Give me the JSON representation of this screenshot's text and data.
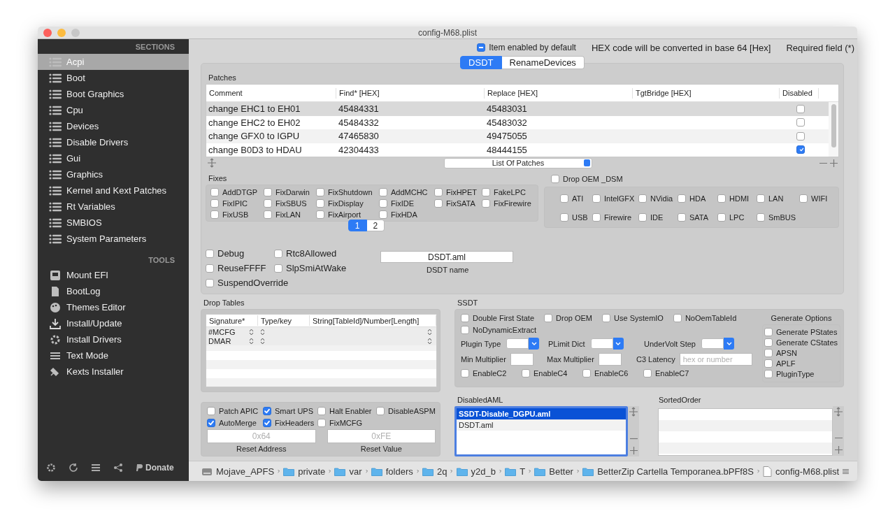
{
  "window": {
    "title": "config-M68.plist"
  },
  "sidebar": {
    "header": "SECTIONS",
    "items": [
      {
        "label": "Acpi",
        "selected": true
      },
      {
        "label": "Boot",
        "selected": false
      },
      {
        "label": "Boot Graphics",
        "selected": false
      },
      {
        "label": "Cpu",
        "selected": false
      },
      {
        "label": "Devices",
        "selected": false
      },
      {
        "label": "Disable Drivers",
        "selected": false
      },
      {
        "label": "Gui",
        "selected": false
      },
      {
        "label": "Graphics",
        "selected": false
      },
      {
        "label": "Kernel and Kext Patches",
        "selected": false
      },
      {
        "label": "Rt Variables",
        "selected": false
      },
      {
        "label": "SMBIOS",
        "selected": false
      },
      {
        "label": "System Parameters",
        "selected": false
      }
    ],
    "tools_header": "TOOLS",
    "tools": [
      {
        "label": "Mount EFI",
        "selected": false
      },
      {
        "label": "BootLog",
        "selected": false
      },
      {
        "label": "Themes Editor",
        "selected": false
      },
      {
        "label": "Install/Update",
        "selected": false
      },
      {
        "label": "Install Drivers",
        "selected": false
      },
      {
        "label": "Text Mode",
        "selected": false
      },
      {
        "label": "Kexts Installer",
        "selected": false
      }
    ],
    "donate": "Donate"
  },
  "header": {
    "item_enabled": {
      "label": "Item enabled by default",
      "mixed": true
    },
    "hex_note": "HEX code will be converted in base 64 [Hex]",
    "required_note": "Required field (*)"
  },
  "tabs": [
    {
      "label": "DSDT",
      "selected": true
    },
    {
      "label": "RenameDevices",
      "selected": false
    }
  ],
  "patches": {
    "title": "Patches",
    "columns": [
      "Comment",
      "Find* [HEX]",
      "Replace [HEX]",
      "TgtBridge [HEX]",
      "Disabled"
    ],
    "rows": [
      {
        "comment": "change EHC1 to EH01",
        "find": "45484331",
        "replace": "45483031",
        "disabled": false
      },
      {
        "comment": "change EHC2 to EH02",
        "find": "45484332",
        "replace": "45483032",
        "disabled": false
      },
      {
        "comment": "change GFX0 to IGPU",
        "find": "47465830",
        "replace": "49475055",
        "disabled": false
      },
      {
        "comment": "change B0D3 to HDAU",
        "find": "42304433",
        "replace": "48444155",
        "disabled": true
      }
    ],
    "list_popup": "List Of Patches"
  },
  "fixes": {
    "title": "Fixes",
    "items": [
      {
        "label": "AddDTGP",
        "checked": false
      },
      {
        "label": "FixDarwin",
        "checked": false
      },
      {
        "label": "FixShutdown",
        "checked": false
      },
      {
        "label": "AddMCHC",
        "checked": false
      },
      {
        "label": "FixHPET",
        "checked": false
      },
      {
        "label": "FakeLPC",
        "checked": false
      },
      {
        "label": "FixIPIC",
        "checked": false
      },
      {
        "label": "FixSBUS",
        "checked": false
      },
      {
        "label": "FixDisplay",
        "checked": false
      },
      {
        "label": "FixIDE",
        "checked": false
      },
      {
        "label": "FixSATA",
        "checked": false
      },
      {
        "label": "FixFirewire",
        "checked": false
      },
      {
        "label": "FixUSB",
        "checked": false
      },
      {
        "label": "FixLAN",
        "checked": false
      },
      {
        "label": "FixAirport",
        "checked": false
      },
      {
        "label": "FixHDA",
        "checked": false
      }
    ],
    "pages": [
      {
        "label": "1",
        "selected": true
      },
      {
        "label": "2",
        "selected": false
      }
    ]
  },
  "drop_oem_dsm": {
    "label": "Drop OEM _DSM",
    "checked": false,
    "items": [
      {
        "label": "ATI",
        "checked": false
      },
      {
        "label": "IntelGFX",
        "checked": false
      },
      {
        "label": "NVidia",
        "checked": false
      },
      {
        "label": "HDA",
        "checked": false
      },
      {
        "label": "HDMI",
        "checked": false
      },
      {
        "label": "LAN",
        "checked": false
      },
      {
        "label": "WIFI",
        "checked": false
      },
      {
        "label": "USB",
        "checked": false
      },
      {
        "label": "Firewire",
        "checked": false
      },
      {
        "label": "IDE",
        "checked": false
      },
      {
        "label": "SATA",
        "checked": false
      },
      {
        "label": "LPC",
        "checked": false
      },
      {
        "label": "SmBUS",
        "checked": false
      }
    ]
  },
  "options": [
    {
      "label": "Debug",
      "checked": false
    },
    {
      "label": "Rtc8Allowed",
      "checked": false
    },
    {
      "label": "ReuseFFFF",
      "checked": false
    },
    {
      "label": "SlpSmiAtWake",
      "checked": false
    },
    {
      "label": "SuspendOverride",
      "checked": false
    }
  ],
  "dsdt_name": {
    "value": "DSDT.aml",
    "label": "DSDT name"
  },
  "drop_tables": {
    "title": "Drop Tables",
    "columns": [
      "Signature*",
      "Type/key",
      "String[TableId]/Number[Length]"
    ],
    "rows": [
      {
        "signature": "#MCFG"
      },
      {
        "signature": "DMAR"
      }
    ]
  },
  "misc": {
    "items": [
      {
        "label": "Patch APIC",
        "checked": false
      },
      {
        "label": "Smart UPS",
        "checked": true
      },
      {
        "label": "Halt Enabler",
        "checked": false
      },
      {
        "label": "DisableASPM",
        "checked": false
      },
      {
        "label": "AutoMerge",
        "checked": true
      },
      {
        "label": "FixHeaders",
        "checked": true
      },
      {
        "label": "FixMCFG",
        "checked": false
      }
    ],
    "reset_address": {
      "placeholder": "0x64",
      "label": "Reset Address"
    },
    "reset_value": {
      "placeholder": "0xFE",
      "label": "Reset Value"
    }
  },
  "ssdt": {
    "title": "SSDT",
    "flags": [
      {
        "label": "Double First State",
        "checked": false
      },
      {
        "label": "Drop OEM",
        "checked": false
      },
      {
        "label": "Use SystemIO",
        "checked": false
      },
      {
        "label": "NoOemTableId",
        "checked": false
      },
      {
        "label": "NoDynamicExtract",
        "checked": false
      }
    ],
    "dropdowns": [
      {
        "label": "Plugin Type"
      },
      {
        "label": "PLimit Dict"
      },
      {
        "label": "UnderVolt Step"
      }
    ],
    "min_multiplier": {
      "label": "Min Multiplier"
    },
    "max_multiplier": {
      "label": "Max Multiplier"
    },
    "c3_latency": {
      "label": "C3 Latency",
      "placeholder": "hex or number"
    },
    "enable_c": [
      {
        "label": "EnableC2",
        "checked": false
      },
      {
        "label": "EnableC4",
        "checked": false
      },
      {
        "label": "EnableC6",
        "checked": false
      },
      {
        "label": "EnableC7",
        "checked": false
      }
    ],
    "generate_options": {
      "title": "Generate Options",
      "items": [
        {
          "label": "Generate PStates",
          "checked": false
        },
        {
          "label": "Generate CStates",
          "checked": false
        },
        {
          "label": "APSN",
          "checked": false
        },
        {
          "label": "APLF",
          "checked": false
        },
        {
          "label": "PluginType",
          "checked": false
        }
      ]
    }
  },
  "disabled_aml": {
    "title": "DisabledAML",
    "items": [
      {
        "label": "SSDT-Disable_DGPU.aml",
        "selected": true
      },
      {
        "label": "DSDT.aml",
        "selected": false
      }
    ]
  },
  "sorted_order": {
    "title": "SortedOrder"
  },
  "path_bar": {
    "items": [
      {
        "label": "Mojave_APFS",
        "kind": "disk"
      },
      {
        "label": "private",
        "kind": "folder"
      },
      {
        "label": "var",
        "kind": "folder"
      },
      {
        "label": "folders",
        "kind": "folder"
      },
      {
        "label": "2q",
        "kind": "folder"
      },
      {
        "label": "y2d_b",
        "kind": "folder"
      },
      {
        "label": "T",
        "kind": "folder"
      },
      {
        "label": "Better",
        "kind": "folder"
      },
      {
        "label": "BetterZip Cartella Temporanea.bPFf8S",
        "kind": "folder"
      },
      {
        "label": "config-M68.plist",
        "kind": "file"
      }
    ]
  }
}
